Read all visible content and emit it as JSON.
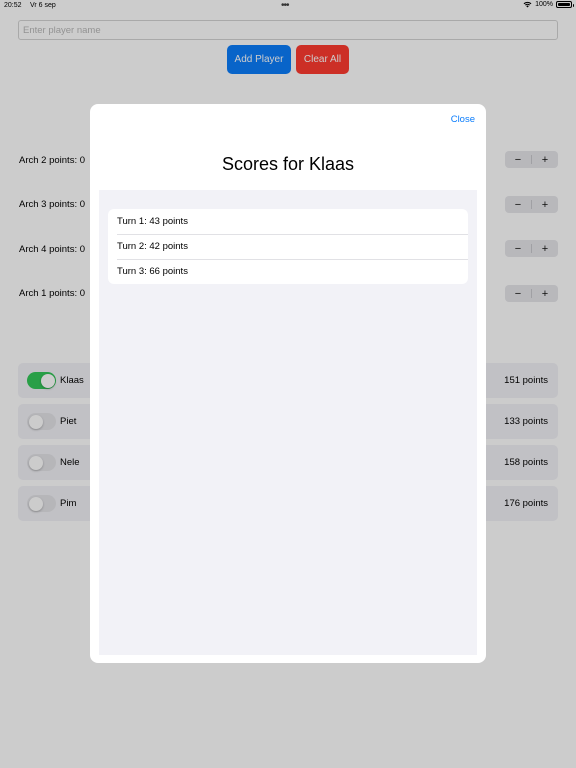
{
  "status_bar": {
    "time": "20:52",
    "date": "Vr 6 sep",
    "battery": "100%"
  },
  "player_input": {
    "placeholder": "Enter player name",
    "value": ""
  },
  "buttons": {
    "add_player": "Add Player",
    "clear_all": "Clear All"
  },
  "arches": [
    {
      "label": "Arch 2 points:",
      "value": "0"
    },
    {
      "label": "Arch 3 points:",
      "value": "0"
    },
    {
      "label": "Arch 4 points:",
      "value": "0"
    },
    {
      "label": "Arch 1 points:",
      "value": "0"
    }
  ],
  "stepper": {
    "minus": "−",
    "plus": "+"
  },
  "players": [
    {
      "name": "Klaas",
      "points": "151 points",
      "active": true
    },
    {
      "name": "Piet",
      "points": "133 points",
      "active": false
    },
    {
      "name": "Nele",
      "points": "158 points",
      "active": false
    },
    {
      "name": "Pim",
      "points": "176 points",
      "active": false
    }
  ],
  "modal": {
    "close": "Close",
    "title": "Scores for Klaas",
    "turns": [
      "Turn 1: 43 points",
      "Turn 2: 42 points",
      "Turn 3: 66 points"
    ]
  },
  "colors": {
    "accent": "#0b7dfc",
    "danger": "#ff3b30",
    "toggle_on": "#34c759"
  },
  "icons": {
    "wifi": "wifi-icon",
    "battery": "battery-icon"
  }
}
